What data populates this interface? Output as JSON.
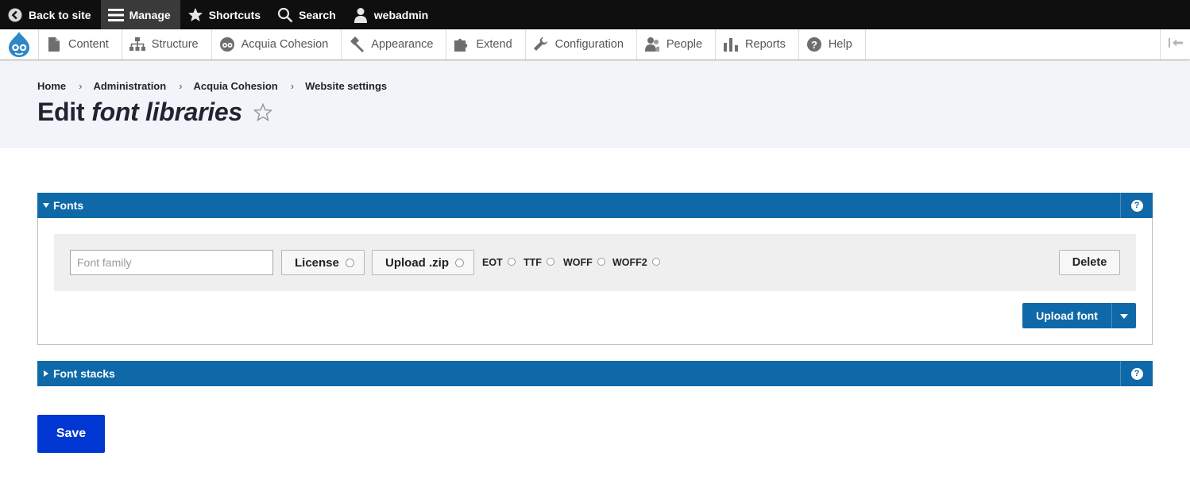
{
  "toolbar": {
    "back_to_site": "Back to site",
    "manage": "Manage",
    "shortcuts": "Shortcuts",
    "search": "Search",
    "user": "webadmin"
  },
  "tray": {
    "items": [
      {
        "label": "Content",
        "icon": "file-icon"
      },
      {
        "label": "Structure",
        "icon": "sitemap-icon"
      },
      {
        "label": "Acquia Cohesion",
        "icon": "cohesion-icon"
      },
      {
        "label": "Appearance",
        "icon": "paintbrush-icon"
      },
      {
        "label": "Extend",
        "icon": "puzzle-icon"
      },
      {
        "label": "Configuration",
        "icon": "wrench-icon"
      },
      {
        "label": "People",
        "icon": "people-icon"
      },
      {
        "label": "Reports",
        "icon": "bar-chart-icon"
      },
      {
        "label": "Help",
        "icon": "help-icon"
      }
    ]
  },
  "breadcrumb": [
    "Home",
    "Administration",
    "Acquia Cohesion",
    "Website settings"
  ],
  "page_title": {
    "prefix": "Edit",
    "emphasis": "font libraries"
  },
  "fonts_section": {
    "label": "Fonts",
    "font_family_placeholder": "Font family",
    "license_label": "License",
    "upload_zip_label": "Upload .zip",
    "formats": [
      "EOT",
      "TTF",
      "WOFF",
      "WOFF2"
    ],
    "delete_label": "Delete",
    "upload_font_label": "Upload font"
  },
  "font_stacks_section": {
    "label": "Font stacks"
  },
  "save_label": "Save",
  "colors": {
    "toolbar_bg": "#0f0f0f",
    "accent_blue": "#0f69a8",
    "primary_button": "#0036d1",
    "header_bg": "#f3f4f9"
  }
}
